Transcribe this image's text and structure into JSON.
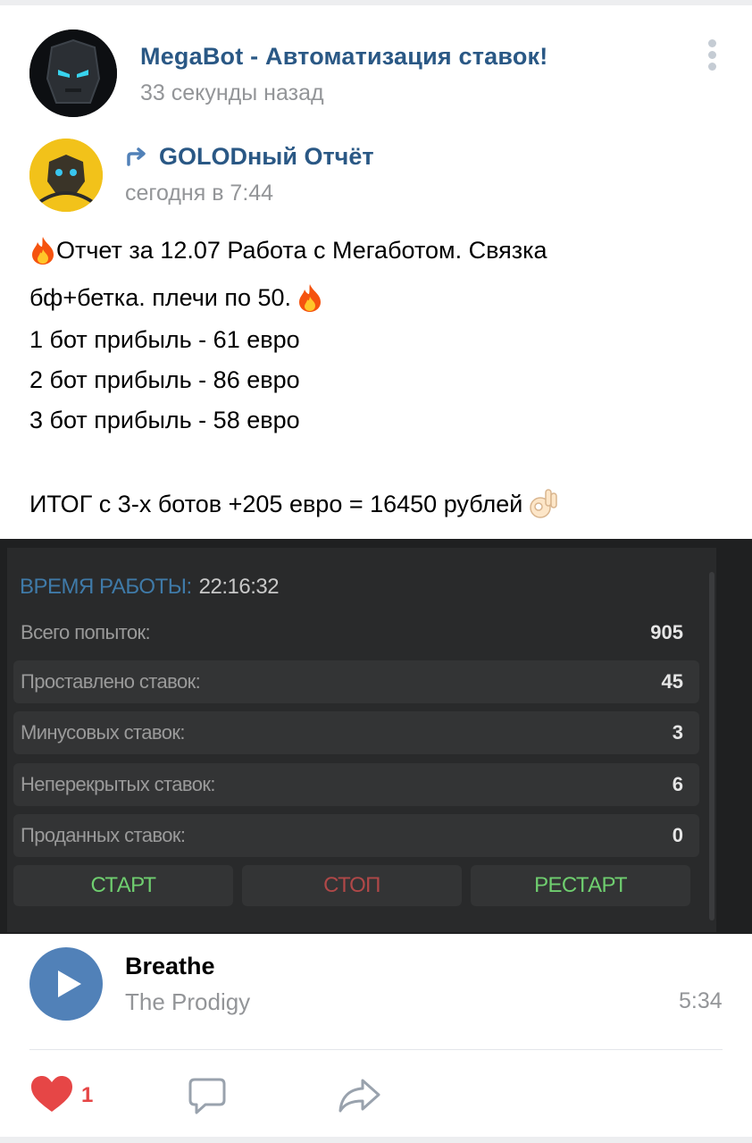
{
  "post": {
    "author": "MegaBot - Автоматизация ставок!",
    "time": "33 секунды назад",
    "menu_icon": "more-vertical-icon"
  },
  "repost": {
    "author": "GOLODный Отчёт",
    "time": "сегодня в 7:44",
    "icon": "repost-arrow-icon"
  },
  "text": {
    "line1": "Отчет за 12.07 Работа с Мегаботом. Связка",
    "line2": "бф+бетка. плечи по 50.",
    "line3": "1 бот прибыль - 61 евро",
    "line4": "2 бот прибыль - 86 евро",
    "line5": "3 бот прибыль - 58 евро",
    "line6": "ИТОГ с 3-х ботов +205 евро = 16450 рублей"
  },
  "bot_panel": {
    "uptime_label": "ВРЕМЯ РАБОТЫ:",
    "uptime_value": "22:16:32",
    "rows": [
      {
        "label": "Всего попыток:",
        "value": "905"
      },
      {
        "label": "Проставлено ставок:",
        "value": "45"
      },
      {
        "label": "Минусовых ставок:",
        "value": "3"
      },
      {
        "label": "Неперекрытых ставок:",
        "value": "6"
      },
      {
        "label": "Проданных ставок:",
        "value": "0"
      }
    ],
    "buttons": {
      "start": "СТАРТ",
      "stop": "СТОП",
      "restart": "РЕСТАРТ"
    },
    "colors": {
      "start": "#6fce6f",
      "stop": "#b04848",
      "restart": "#6fce6f"
    }
  },
  "audio": {
    "title": "Breathe",
    "artist": "The Prodigy",
    "duration": "5:34"
  },
  "actions": {
    "likes": "1"
  },
  "colors": {
    "link": "#2a5885",
    "muted": "#939598",
    "accent": "#5181b8",
    "like": "#e64646"
  }
}
